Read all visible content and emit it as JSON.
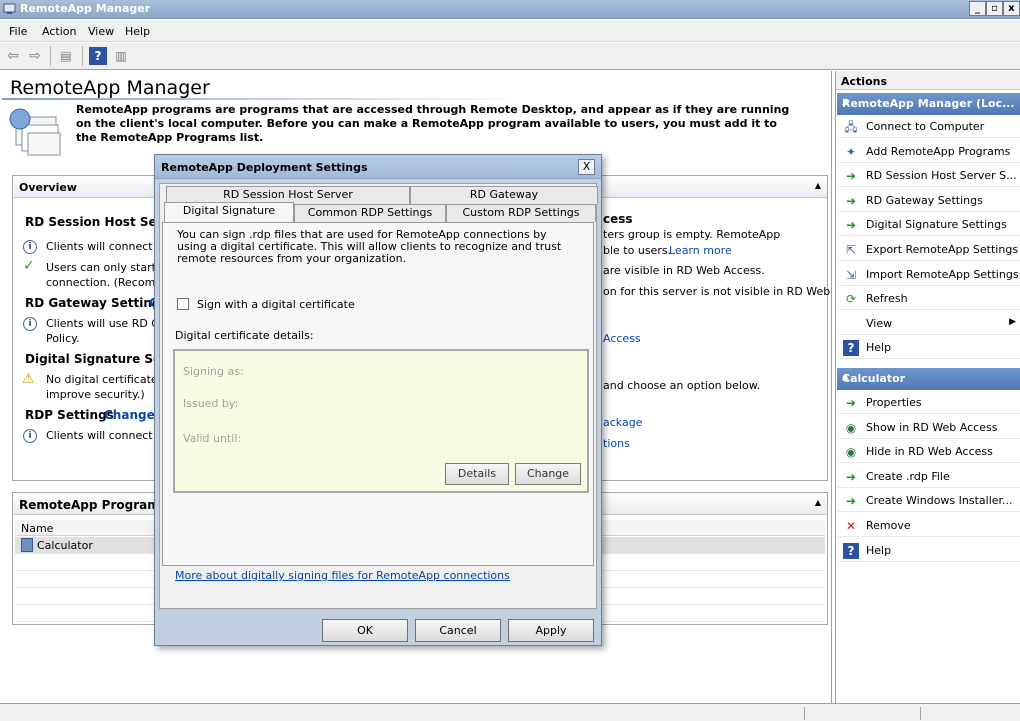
{
  "window": {
    "title": "RemoteApp Manager"
  },
  "menu": [
    "File",
    "Action",
    "View",
    "Help"
  ],
  "main": {
    "title": "RemoteApp Manager",
    "description": "RemoteApp programs are programs that are accessed through Remote Desktop, and appear as if they are running on the client's local computer. Before you can make a RemoteApp program available to users, you must add it to the RemoteApp Programs list."
  },
  "overview": {
    "header": "Overview",
    "rdsh_heading": "RD Session Host Server",
    "rdsh_line1": "Clients will connect t",
    "rdsh_line2": "Users can only start l",
    "rdsh_line3": "connection. (Recom",
    "gateway_heading": "RD Gateway Settings",
    "gateway_change": "C",
    "gateway_line1": "Clients will use RD G",
    "gateway_line2": "Policy.",
    "digsig_heading": "Digital Signature Settin",
    "digsig_line1": "No digital certificate",
    "digsig_line2": "improve security.)",
    "rdp_heading": "RDP Settings",
    "rdp_change": "Change",
    "rdp_line1": "Clients will connect v",
    "right_heading": "cess",
    "right_line1": "ters group is empty. RemoteApp",
    "right_line2": "ble to users.",
    "right_learn_more": "Learn more",
    "right_line3": "are visible in RD Web Access.",
    "right_line4": "on for this server is not visible in RD Web",
    "right_access": "Access",
    "right_line5": "and choose an option below.",
    "right_package": "ackage",
    "right_options": "tions"
  },
  "programs": {
    "header": "RemoteApp Programs",
    "column_name": "Name",
    "rows": [
      "Calculator"
    ]
  },
  "actions": {
    "title": "Actions",
    "section1": "RemoteApp Manager (Loc...",
    "items1": [
      {
        "icon": "connect-icon",
        "label": "Connect to Computer"
      },
      {
        "icon": "add-programs-icon",
        "label": "Add RemoteApp Programs"
      },
      {
        "icon": "green-arrow-icon",
        "label": "RD Session Host Server S..."
      },
      {
        "icon": "green-arrow-icon",
        "label": "RD Gateway Settings"
      },
      {
        "icon": "green-arrow-icon",
        "label": "Digital Signature Settings"
      },
      {
        "icon": "export-icon",
        "label": "Export RemoteApp Settings"
      },
      {
        "icon": "import-icon",
        "label": "Import RemoteApp Settings"
      },
      {
        "icon": "refresh-icon",
        "label": "Refresh"
      },
      {
        "icon": "",
        "label": "View"
      },
      {
        "icon": "help-icon",
        "label": "Help"
      }
    ],
    "section2": "Calculator",
    "items2": [
      {
        "icon": "green-arrow-icon",
        "label": "Properties"
      },
      {
        "icon": "globe-icon",
        "label": "Show in RD Web Access"
      },
      {
        "icon": "globe-icon",
        "label": "Hide in RD Web Access"
      },
      {
        "icon": "green-arrow-icon",
        "label": "Create .rdp File"
      },
      {
        "icon": "green-arrow-icon",
        "label": "Create Windows Installer..."
      },
      {
        "icon": "remove-icon",
        "label": "Remove"
      },
      {
        "icon": "help-icon",
        "label": "Help"
      }
    ]
  },
  "dialog": {
    "title": "RemoteApp Deployment Settings",
    "close": "X",
    "tabs_row1": [
      "RD Session Host Server",
      "RD Gateway"
    ],
    "tabs_row2": [
      "Digital Signature",
      "Common RDP Settings",
      "Custom RDP Settings"
    ],
    "sig_description": "You can sign .rdp files that are used for RemoteApp connections by using a digital certificate. This will allow clients to recognize and trust remote resources from your organization.",
    "checkbox_label": "Sign with a digital certificate",
    "details_label": "Digital certificate details:",
    "signing_as": "Signing as:",
    "issued_by": "Issued by:",
    "valid_until": "Valid until:",
    "details_button": "Details",
    "change_button": "Change",
    "more_link": "More about digitally signing files for RemoteApp connections",
    "ok": "OK",
    "cancel": "Cancel",
    "apply": "Apply"
  }
}
